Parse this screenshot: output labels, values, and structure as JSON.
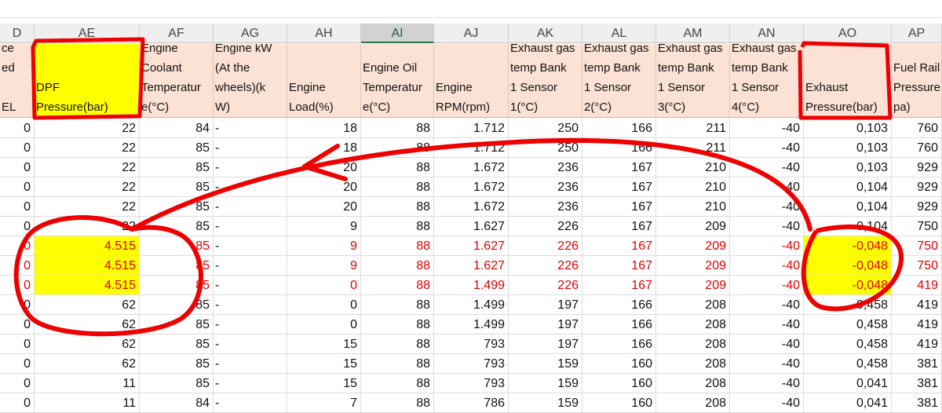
{
  "columns": [
    "D",
    "AE",
    "AF",
    "AG",
    "AH",
    "AI",
    "AJ",
    "AK",
    "AL",
    "AM",
    "AN",
    "AO",
    "AP"
  ],
  "selected_column": "AI",
  "headers": [
    "ce\ned\n\nEL",
    "DPF\nPressure(bar)",
    "Engine\nCoolant\nTemperatur\ne(°C)",
    "Engine kW\n(At the\nwheels)(k\nW)",
    "Engine\nLoad(%)",
    "Engine Oil\nTemperatur\ne(°C)",
    "Engine\nRPM(rpm)",
    "Exhaust gas\ntemp Bank\n1 Sensor\n1(°C)",
    "Exhaust gas\ntemp Bank\n1 Sensor\n2(°C)",
    "Exhaust gas\ntemp Bank\n1 Sensor\n3(°C)",
    "Exhaust gas\ntemp Bank\n1 Sensor\n4(°C)",
    "Exhaust\nPressure(bar)",
    "Fuel Rail\nPressure\npa)"
  ],
  "rows": [
    [
      "0",
      "22",
      "84",
      "-",
      "18",
      "88",
      "1.712",
      "250",
      "166",
      "211",
      "-40",
      "0,103",
      "760"
    ],
    [
      "0",
      "22",
      "85",
      "-",
      "18",
      "88",
      "1.712",
      "250",
      "166",
      "211",
      "-40",
      "0,103",
      "760"
    ],
    [
      "0",
      "22",
      "85",
      "-",
      "20",
      "88",
      "1.672",
      "236",
      "167",
      "210",
      "-40",
      "0,103",
      "929"
    ],
    [
      "0",
      "22",
      "85",
      "-",
      "20",
      "88",
      "1.672",
      "236",
      "167",
      "210",
      "-40",
      "0,104",
      "929"
    ],
    [
      "0",
      "22",
      "85",
      "-",
      "20",
      "88",
      "1.672",
      "236",
      "167",
      "210",
      "-40",
      "0,104",
      "929"
    ],
    [
      "0",
      "22",
      "85",
      "-",
      "9",
      "88",
      "1.627",
      "226",
      "167",
      "209",
      "-40",
      "0,104",
      "750"
    ],
    [
      "0",
      "4.515",
      "85",
      "-",
      "9",
      "88",
      "1.627",
      "226",
      "167",
      "209",
      "-40",
      "-0,048",
      "750"
    ],
    [
      "0",
      "4.515",
      "85",
      "-",
      "9",
      "88",
      "1.627",
      "226",
      "167",
      "209",
      "-40",
      "-0,048",
      "750"
    ],
    [
      "0",
      "4.515",
      "85",
      "-",
      "0",
      "88",
      "1.499",
      "226",
      "167",
      "209",
      "-40",
      "-0,048",
      "419"
    ],
    [
      "0",
      "62",
      "85",
      "-",
      "0",
      "88",
      "1.499",
      "197",
      "166",
      "208",
      "-40",
      "0,458",
      "419"
    ],
    [
      "0",
      "62",
      "85",
      "-",
      "0",
      "88",
      "1.499",
      "197",
      "166",
      "208",
      "-40",
      "0,458",
      "419"
    ],
    [
      "0",
      "62",
      "85",
      "-",
      "15",
      "88",
      "793",
      "197",
      "166",
      "208",
      "-40",
      "0,458",
      "419"
    ],
    [
      "0",
      "62",
      "85",
      "-",
      "15",
      "88",
      "793",
      "159",
      "160",
      "208",
      "-40",
      "0,458",
      "381"
    ],
    [
      "0",
      "11",
      "85",
      "-",
      "15",
      "88",
      "793",
      "159",
      "160",
      "208",
      "-40",
      "0,041",
      "381"
    ],
    [
      "0",
      "11",
      "84",
      "-",
      "7",
      "88",
      "786",
      "159",
      "160",
      "208",
      "-40",
      "0,041",
      "381"
    ]
  ],
  "highlight_rows": [
    6,
    7,
    8
  ],
  "colors": {
    "header_fill": "#fbe2d5",
    "highlight": "#ffff00",
    "error_text": "#e00000",
    "annotation": "#ee0000"
  }
}
